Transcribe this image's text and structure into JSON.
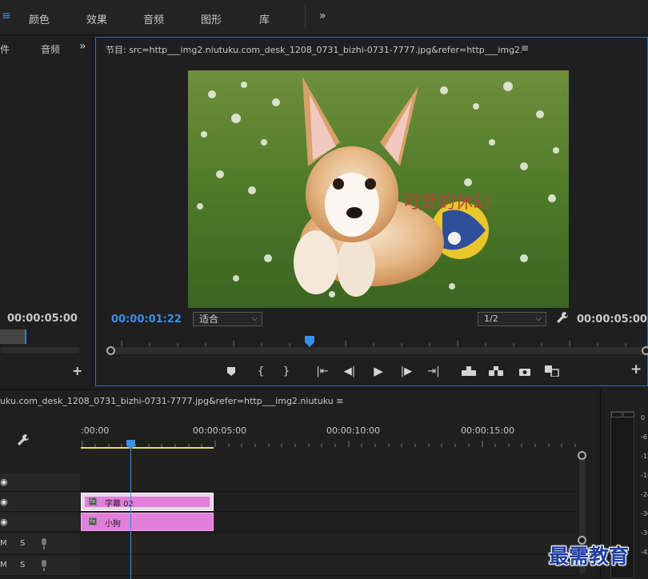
{
  "top_tabs": {
    "menu_icon": "≡",
    "items": [
      "颜色",
      "效果",
      "音频",
      "图形",
      "库"
    ],
    "more": "»"
  },
  "left_panel": {
    "tab_partial": "件",
    "tab_audio": "音频",
    "more": "»",
    "timecode": "00:00:05:00",
    "add": "+"
  },
  "program": {
    "title": "节目: src=http___img2.niutuku.com_desk_1208_0731_bizhi-0731-7777.jpg&refer=http___img2.niutuku",
    "menu": "≡",
    "overlay_text": "可爱的休幻",
    "current_timecode": "00:00:01:22",
    "fit_select": "适合",
    "resolution_select": "1/2",
    "duration_timecode": "00:00:05:00",
    "add": "+"
  },
  "timeline": {
    "title": "uku.com_desk_1208_0731_bizhi-0731-7777.jpg&refer=http___img2.niutuku  ≡",
    "ruler_labels": [
      ":00:00",
      "00:00:05:00",
      "00:00:10:00",
      "00:00:15:00"
    ],
    "tracks": [
      {
        "label": "",
        "icon": "eye-icon",
        "glyph": "◉"
      },
      {
        "label": "",
        "icon": "eye-icon",
        "glyph": "◉"
      },
      {
        "label": "",
        "icon": "eye-icon",
        "glyph": "◉"
      },
      {
        "m": "M",
        "s": "S",
        "icon": "mic-icon"
      },
      {
        "m": "M",
        "s": "S",
        "icon": "mic-icon"
      }
    ],
    "clips": [
      {
        "name": "字幕 02",
        "fx": "fx",
        "track": 1
      },
      {
        "name": "小狗",
        "fx": "fx",
        "track": 2
      }
    ]
  },
  "meter": {
    "labels": [
      "0",
      "-6",
      "-12",
      "-18",
      "-24",
      "-30",
      "-36",
      "-42"
    ]
  },
  "watermark": "最需教育",
  "colors": {
    "accent": "#3b8fe8",
    "clip": "#e17fdb",
    "work_area": "#e8e14a"
  }
}
